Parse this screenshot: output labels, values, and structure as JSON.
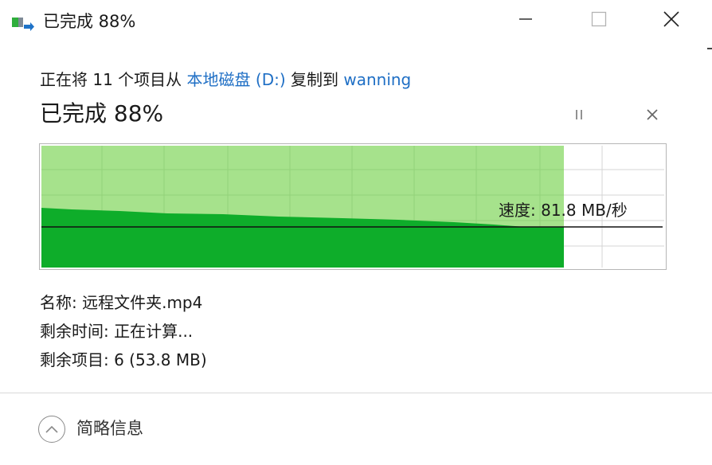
{
  "window": {
    "title": "已完成 88%",
    "accent_link_color": "#1f6fc5"
  },
  "copy": {
    "prefix": "正在将 11 个项目从 ",
    "source": "本地磁盘 (D:)",
    "middle": " 复制到 ",
    "destination": "wanning"
  },
  "progress": {
    "title": "已完成 88%",
    "fraction": 0.88,
    "speed_label": "速度: 81.8 MB/秒"
  },
  "details": {
    "name": "名称: 远程文件夹.mp4",
    "time_remaining": "剩余时间: 正在计算...",
    "items_remaining": "剩余项目: 6 (53.8 MB)"
  },
  "footer": {
    "toggle_label": "简略信息"
  },
  "colors": {
    "graph_light_green": "#a6e28c",
    "graph_dark_green": "#0ead2a",
    "graph_grid": "#d4d4d4"
  }
}
